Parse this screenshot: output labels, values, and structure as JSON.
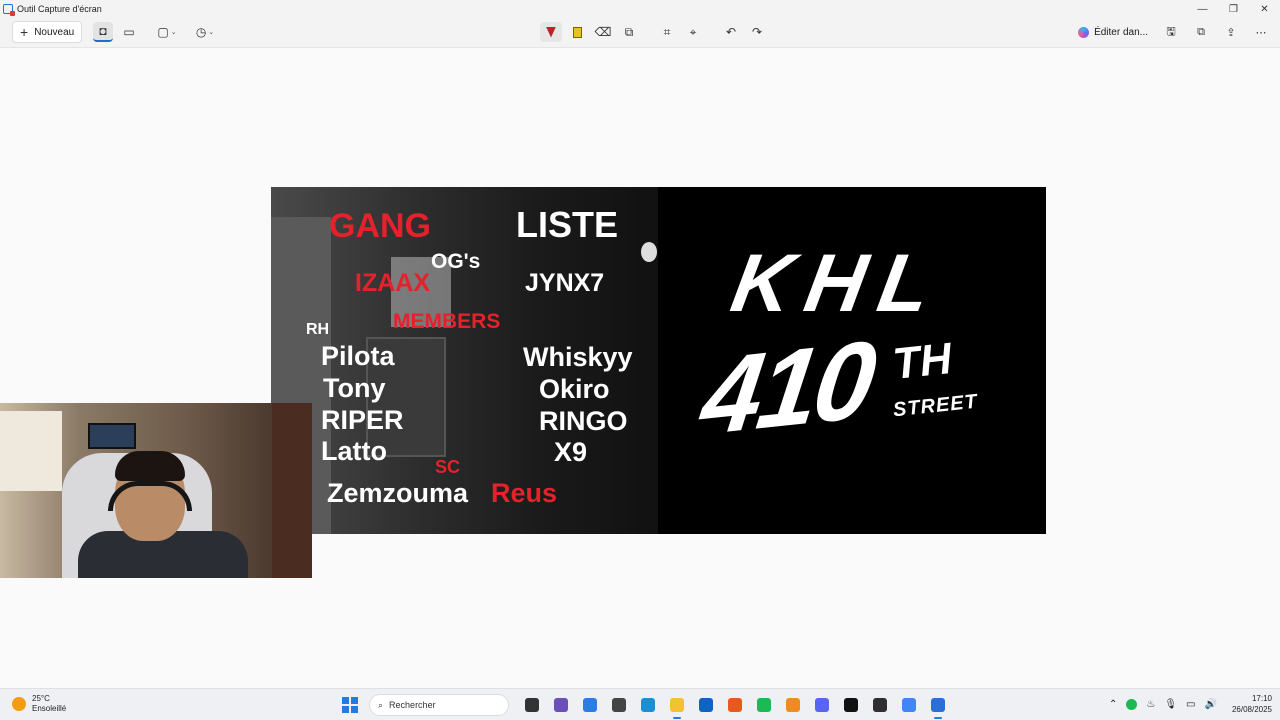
{
  "window": {
    "title": "Outil Capture d'écran",
    "minimize_glyph": "—",
    "restore_glyph": "❐",
    "close_glyph": "✕"
  },
  "toolbar": {
    "new_label": "Nouveau",
    "new_glyph": "+",
    "photo_glyph": "◘",
    "video_glyph": "▭",
    "shape_glyph": "▢",
    "timer_glyph": "◷",
    "chevron_glyph": "⌄",
    "eraser_glyph": "⌫",
    "shapes_glyph": "⧉",
    "crop_glyph": "⌗",
    "text_action_glyph": "⌖",
    "undo_glyph": "↶",
    "redo_glyph": "↷",
    "edit_in_label": "Éditer dan...",
    "save_glyph": "🖫",
    "copy_glyph": "⧉",
    "share_glyph": "⇪",
    "more_glyph": "⋯"
  },
  "capture": {
    "gang": "GANG",
    "liste": "LISTE",
    "izaax": "IZAAX",
    "ogs": "OG's",
    "jynx7": "JYNX7",
    "rh": "RH",
    "members": "MEMBERS",
    "left_names": [
      "Pilota",
      "Tony",
      "RIPER",
      "Latto"
    ],
    "right_names": [
      "Whiskyy",
      "Okiro",
      "RINGO",
      "X9"
    ],
    "sc": "SC",
    "zemzouma": "Zemzouma",
    "reus": "Reus",
    "khl": "KHL",
    "num_410": "410",
    "th": "TH",
    "street": "STREET"
  },
  "taskbar": {
    "temperature": "25°C",
    "weather": "Ensoleillé",
    "search_placeholder": "Rechercher",
    "search_glyph": "⌕",
    "time": "17:10",
    "date": "26/08/2025",
    "apps": [
      {
        "name": "task-view-icon",
        "color": "#333333"
      },
      {
        "name": "media-app-icon",
        "color": "#6b4fbb"
      },
      {
        "name": "store-icon",
        "color": "#2a7de1"
      },
      {
        "name": "files-icon",
        "color": "#444444"
      },
      {
        "name": "edge-icon",
        "color": "#1b8fd6"
      },
      {
        "name": "file-explorer-icon",
        "color": "#f2c230"
      },
      {
        "name": "outlook-icon",
        "color": "#0f64c2"
      },
      {
        "name": "firefox-icon",
        "color": "#e8591c"
      },
      {
        "name": "spotify-icon",
        "color": "#1db954"
      },
      {
        "name": "app-a-icon",
        "color": "#f08a24"
      },
      {
        "name": "discord-icon",
        "color": "#5865f2"
      },
      {
        "name": "capcut-icon",
        "color": "#111111"
      },
      {
        "name": "obs-icon",
        "color": "#302e31"
      },
      {
        "name": "chrome-icon",
        "color": "#4285f4"
      },
      {
        "name": "snipping-tool-icon",
        "color": "#2a6fd6"
      }
    ],
    "tray_glyphs": {
      "chevron": "⌃",
      "steam": "♨",
      "mic": "🎙",
      "display": "▭",
      "volume": "🔊"
    }
  }
}
